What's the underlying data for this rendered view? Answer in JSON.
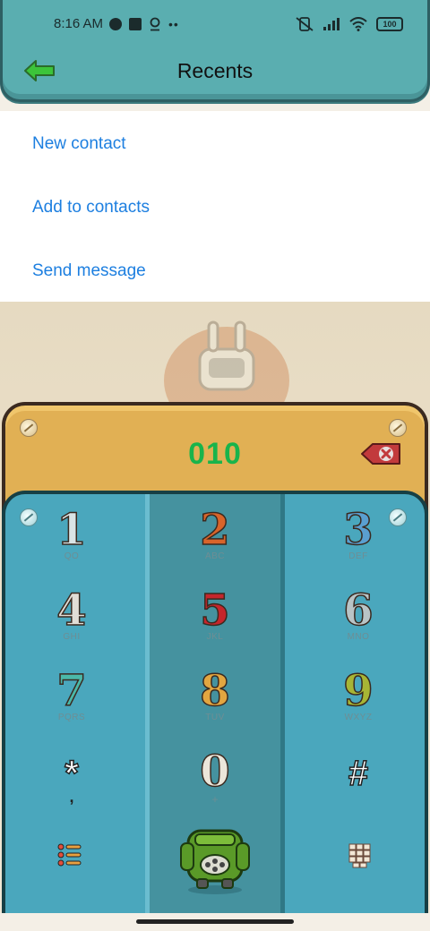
{
  "status": {
    "time": "8:16 AM",
    "battery": "100"
  },
  "header": {
    "title": "Recents"
  },
  "menu": {
    "items": [
      "New contact",
      "Add to contacts",
      "Send message"
    ]
  },
  "dialer": {
    "number": "010"
  },
  "keypad": {
    "keys": [
      {
        "digit": "1",
        "letters": "QO"
      },
      {
        "digit": "2",
        "letters": "ABC"
      },
      {
        "digit": "3",
        "letters": "DEF"
      },
      {
        "digit": "4",
        "letters": "GHI"
      },
      {
        "digit": "5",
        "letters": "JKL"
      },
      {
        "digit": "6",
        "letters": "MNO"
      },
      {
        "digit": "7",
        "letters": "PQRS"
      },
      {
        "digit": "8",
        "letters": "TUV"
      },
      {
        "digit": "9",
        "letters": "WXYZ"
      }
    ],
    "star": "*",
    "star_sub": ",",
    "zero": "0",
    "zero_sub": "+",
    "hash": "#"
  },
  "colors": {
    "accent_link": "#1d7fe0",
    "number": "#19b44b",
    "header": "#5aaeb0",
    "display": "#e1b054",
    "keypad": "#4aa7bd"
  },
  "icons": [
    "back-arrow-icon",
    "backspace-icon",
    "menu-list-icon",
    "dialpad-grid-icon",
    "call-robot-icon"
  ]
}
